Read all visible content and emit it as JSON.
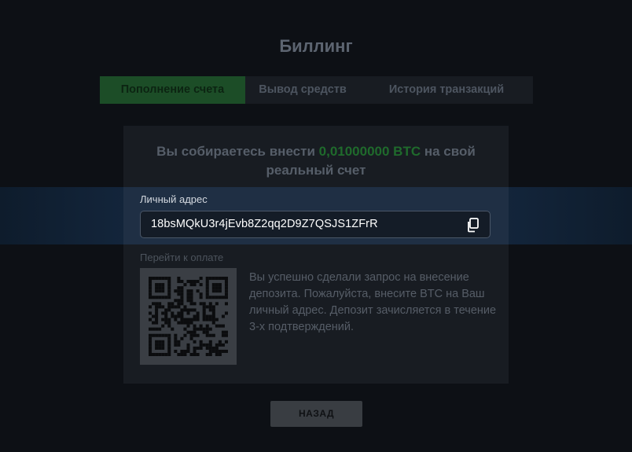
{
  "page": {
    "title": "Биллинг"
  },
  "tabs": [
    {
      "label": "Пополнение счета",
      "active": true
    },
    {
      "label": "Вывод средств",
      "active": false
    },
    {
      "label": "История транзакций",
      "active": false
    }
  ],
  "deposit": {
    "headline_before": "Вы собираетесь внести ",
    "amount": "0,01000000 BTC",
    "headline_after": " на свой реальный счет",
    "address_label": "Личный адрес",
    "address": "18bsMQkU3r4jEvb8Z2qq2D9Z7QSJS1ZFrR",
    "copy_icon": "copy-icon",
    "payment_label": "Перейти к оплате",
    "qr_icon": "qr-code",
    "instructions": "Вы успешно сделали запрос на внесение депозита. Пожалуйста, внесите BTC на Ваш личный адрес. Депозит зачисляется в течение 3-х подтверждений."
  },
  "back_button": {
    "label": "НАЗАД"
  },
  "colors": {
    "background": "#0d1015",
    "card": "#181c22",
    "accent_green": "#1f6a2c",
    "active_tab": "#1c4d27",
    "highlight_band": "#1f2f44"
  }
}
